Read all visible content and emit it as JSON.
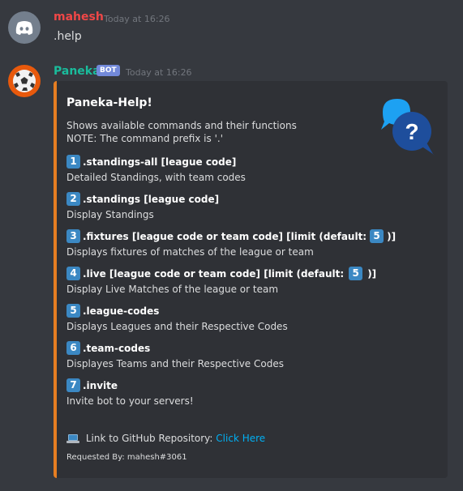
{
  "message1": {
    "username": "mahesh",
    "timestamp": "Today at 16:26",
    "content": ".help"
  },
  "message2": {
    "username": "Paneka",
    "bot_tag": "BOT",
    "timestamp": "Today at 16:26"
  },
  "embed": {
    "title": "Paneka-Help!",
    "desc_line1": "Shows available commands and their functions",
    "desc_line2": "NOTE: The command prefix is '.'",
    "commands": [
      {
        "num": "1",
        "cmd": ".standings-all [league code]",
        "desc": "Detailed Standings, with team codes"
      },
      {
        "num": "2",
        "cmd": ".standings [league code]",
        "desc": "Display Standings"
      },
      {
        "num": "3",
        "cmd": ".fixtures [league code or team code] [limit (default:",
        "cmd_num": "5",
        "cmd_end": ")]",
        "desc": "Displays fixtures of matches of the league or team"
      },
      {
        "num": "4",
        "cmd": ".live [league code or team code] [limit (default:",
        "cmd_num": "5",
        "cmd_end": ")]",
        "desc": "Display Live Matches of the league or team"
      },
      {
        "num": "5",
        "cmd": ".league-codes",
        "desc": "Displays Leagues and their Respective Codes"
      },
      {
        "num": "6",
        "cmd": ".team-codes",
        "desc": "Displayes Teams and their Respective Codes"
      },
      {
        "num": "7",
        "cmd": ".invite",
        "desc": "Invite bot to your servers!"
      }
    ],
    "github_text": "Link to GitHub Repository:",
    "github_link": "Click Here",
    "footer": "Requested By: mahesh#3061"
  },
  "colors": {
    "accent_bar": "#e67e22",
    "username_mahesh": "#f04747",
    "username_paneka": "#1abc9c",
    "bot_tag": "#7289da",
    "link": "#00b0f4",
    "keycap": "#3b88c3"
  },
  "icons": {
    "user_avatar": "discord-logo-icon",
    "bot_avatar": "soccer-ball-icon",
    "thumbnail": "help-speech-bubbles-icon",
    "github_prefix": "laptop-icon"
  }
}
